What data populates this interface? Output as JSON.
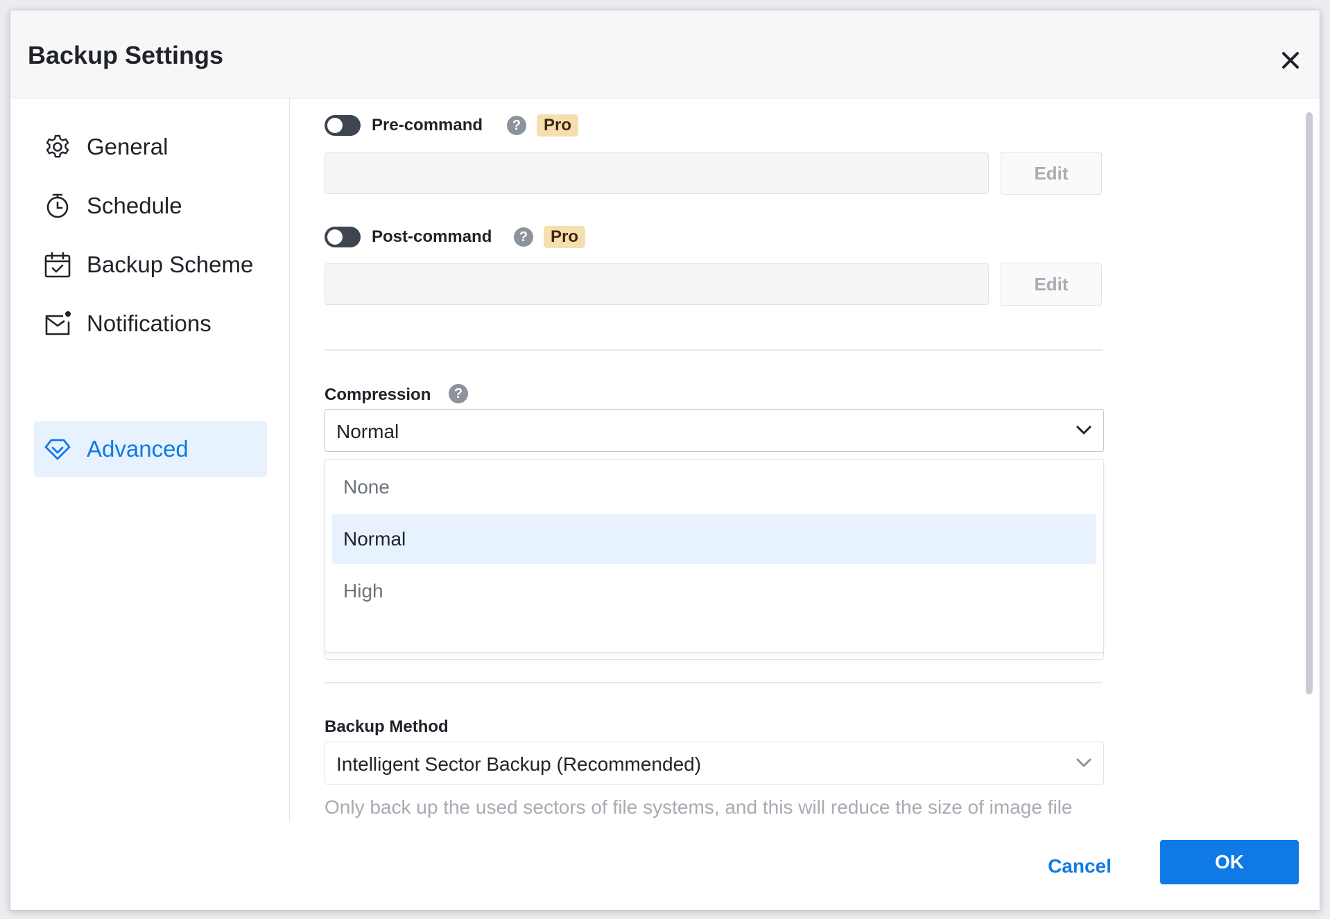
{
  "dialog": {
    "title": "Backup Settings"
  },
  "sidebar": {
    "items": [
      {
        "label": "General",
        "icon": "gear-icon",
        "active": false
      },
      {
        "label": "Schedule",
        "icon": "timer-icon",
        "active": false
      },
      {
        "label": "Backup Scheme",
        "icon": "calendar-check-icon",
        "active": false
      },
      {
        "label": "Notifications",
        "icon": "mail-notification-icon",
        "active": false
      },
      {
        "label": "Advanced",
        "icon": "diamond-icon",
        "active": true
      }
    ]
  },
  "advanced": {
    "pre_command": {
      "label": "Pre-command",
      "badge": "Pro",
      "enabled": false,
      "value": "",
      "edit_label": "Edit"
    },
    "post_command": {
      "label": "Post-command",
      "badge": "Pro",
      "enabled": false,
      "value": "",
      "edit_label": "Edit"
    },
    "compression": {
      "label": "Compression",
      "selected": "Normal",
      "options": [
        "None",
        "Normal",
        "High"
      ]
    },
    "backup_method": {
      "label": "Backup Method",
      "selected": "Intelligent Sector Backup (Recommended)",
      "description": "Only back up the used sectors of file systems, and this will reduce the size of image file and backup time."
    }
  },
  "footer": {
    "cancel_label": "Cancel",
    "ok_label": "OK"
  },
  "colors": {
    "accent": "#0f7ae5",
    "pro_badge": "#f6dfae",
    "active_nav_bg": "#e8f2fe"
  }
}
